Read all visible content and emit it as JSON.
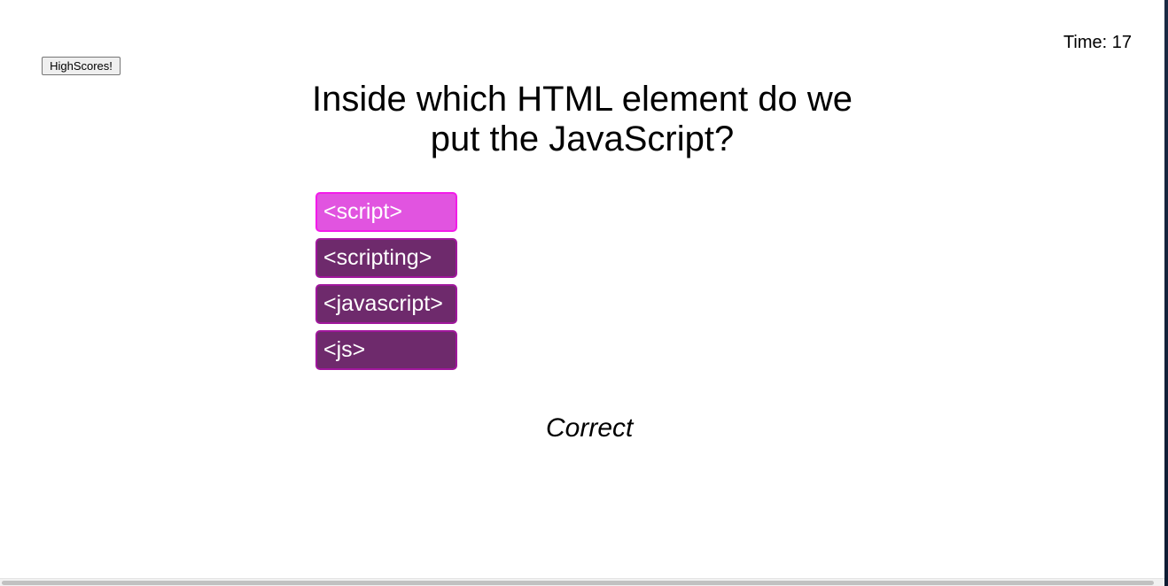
{
  "header": {
    "highscores_label": "HighScores!",
    "timer_text": "Time: 17"
  },
  "quiz": {
    "question": "Inside which HTML element do we put the JavaScript?",
    "answers": [
      {
        "label": "<script>",
        "state": "hovered"
      },
      {
        "label": "<scripting>",
        "state": "default"
      },
      {
        "label": "<javascript>",
        "state": "default"
      },
      {
        "label": "<js>",
        "state": "default"
      }
    ],
    "result": "Correct"
  },
  "colors": {
    "answer_bg": "#6e2a6c",
    "answer_border": "#a0169c",
    "answer_hover_bg": "#e154e0",
    "answer_text": "#ffffff"
  }
}
